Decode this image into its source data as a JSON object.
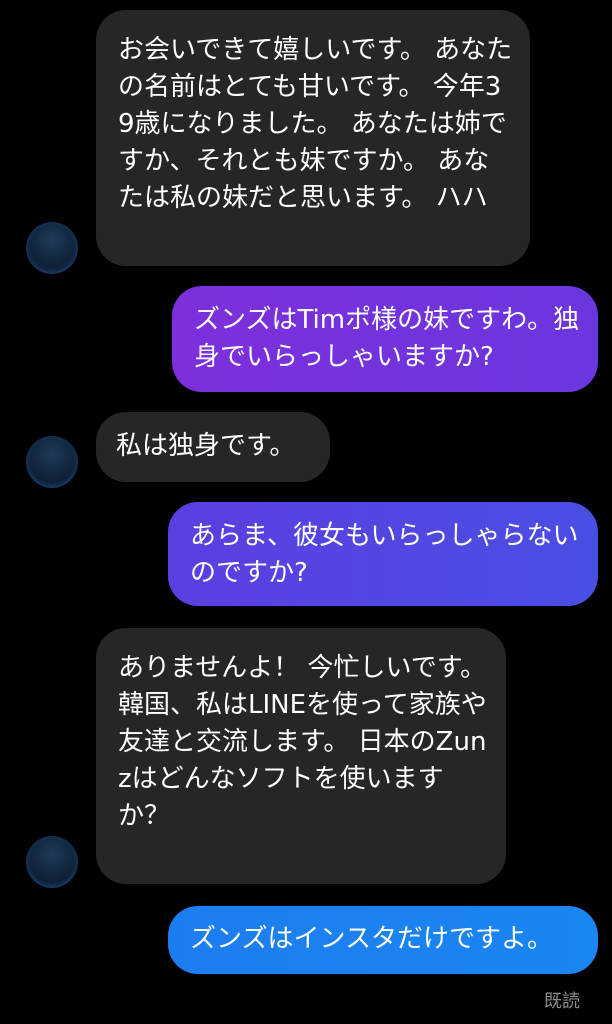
{
  "messages": [
    {
      "from": "them",
      "text": "お会いできて嬉しいです。 あなたの名前はとても甘いです。 今年39歳になりました。 あなたは姉ですか、それとも妹ですか。 あなたは私の妹だと思います。 ハハ"
    },
    {
      "from": "me",
      "text": "ズンズはTimポ様の妹ですわ。独身でいらっしゃいますか?"
    },
    {
      "from": "them",
      "text": "私は独身です。"
    },
    {
      "from": "me",
      "text": "あらま、彼女もいらっしゃらないのですか?"
    },
    {
      "from": "them",
      "text": "ありませんよ！ 今忙しいです。\n韓国、私はLINEを使って家族や友達と交流します。 日本のZunzはどんなソフトを使いますか？"
    },
    {
      "from": "me",
      "text": "ズンズはインスタだけですよ。"
    }
  ],
  "status": {
    "read_receipt": "既読"
  },
  "colors": {
    "incoming_bubble": "#262626",
    "outgoing_top": "#7b2fd6",
    "outgoing_mid": "#4b4ee0",
    "outgoing_bottom": "#1d7ef0"
  }
}
